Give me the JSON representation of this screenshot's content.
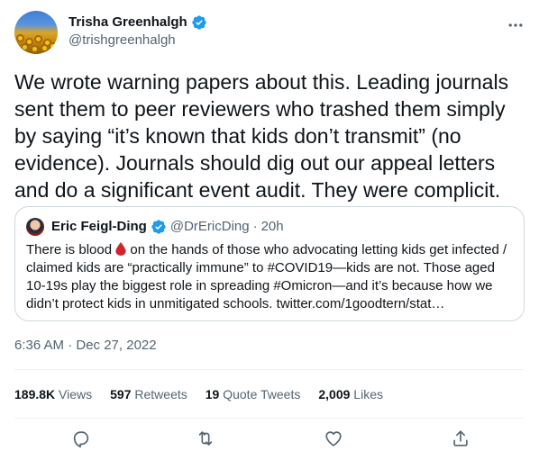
{
  "author": {
    "display_name": "Trisha Greenhalgh",
    "handle": "@trishgreenhalgh",
    "verified": true
  },
  "tweet": {
    "text": "We wrote warning papers about this. Leading journals sent them to peer reviewers who trashed them simply by saying “it’s known that kids don’t transmit” (no evidence). Journals should dig out our appeal letters and do a significant event audit. They were complicit.",
    "timestamp": "6:36 AM · Dec 27, 2022"
  },
  "quoted_tweet": {
    "display_name": "Eric Feigl-Ding",
    "handle": "@DrEricDing",
    "separator": "·",
    "age": "20h",
    "text_before_emoji": "There is blood ",
    "text_after_emoji": " on the hands of those who advocating letting kids get infected / claimed kids are “practically immune” to #COVID19—kids are not. Those aged 10-19s play the biggest role in spreading #Omicron—and it’s because how we didn’t protect kids in unmitigated schools. twitter.com/1goodtern/stat…"
  },
  "stats": {
    "views_count": "189.8K",
    "views_label": "Views",
    "retweets_count": "597",
    "retweets_label": "Retweets",
    "quotes_count": "19",
    "quotes_label": "Quote Tweets",
    "likes_count": "2,009",
    "likes_label": "Likes"
  },
  "icons": [
    "verified-badge-icon",
    "more-icon",
    "reply-icon",
    "retweet-icon",
    "like-icon",
    "share-icon",
    "blood-drop-icon"
  ],
  "colors": {
    "verified": "#1d9bf0",
    "secondary_text": "#536471",
    "border": "#cfd9de",
    "blood_drop": "#d1242f"
  }
}
